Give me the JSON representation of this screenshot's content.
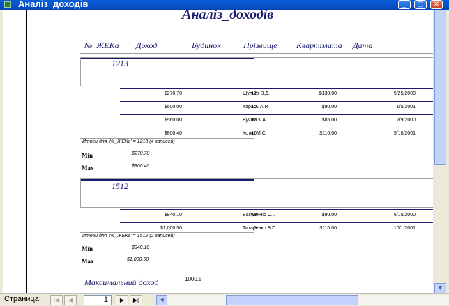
{
  "window": {
    "title": "Аналіз_доходів",
    "buttons": {
      "minimize": "_",
      "maximize": "□",
      "close": "✕"
    }
  },
  "report": {
    "title": "Аналіз_доходів",
    "headers": {
      "zheka": "№_ЖЕКа",
      "dohid": "Доход",
      "budynok": "Будинок",
      "prizvyshche": "Прізвище",
      "kvartplata": "Квартплата",
      "data": "Дата"
    },
    "groups": [
      {
        "id": "1213",
        "rows": [
          {
            "dohid": "$270.70",
            "budynok": "12",
            "prizvyshche": "Шульга В.Д.",
            "kvartplata": "$130.00",
            "data": "5/25/2000"
          },
          {
            "dohid": "$500.00",
            "budynok": "10",
            "prizvyshche": "Карась А.Р.",
            "kvartplata": "$90.00",
            "data": "1/5/2001"
          },
          {
            "dohid": "$560.00",
            "budynok": "12",
            "prizvyshche": "Бучма К.А.",
            "kvartplata": "$85.00",
            "data": "2/9/2000"
          },
          {
            "dohid": "$800.40",
            "budynok": "10",
            "prizvyshche": "Котко М.С.",
            "kvartplata": "$110.00",
            "data": "5/10/2001"
          }
        ],
        "summary": "Итоги для '№_ЖЕКа' = 1213 (4 записей)",
        "min_label": "Min",
        "min_value": "$270.70",
        "max_label": "Max",
        "max_value": "$800.40"
      },
      {
        "id": "1512",
        "rows": [
          {
            "dohid": "$940.10",
            "budynok": "59",
            "prizvyshche": "Бакуленко С.І.",
            "kvartplata": "$90.00",
            "data": "6/15/2000"
          },
          {
            "dohid": "$1,000.50",
            "budynok": "5",
            "prizvyshche": "Титаренко В.П.",
            "kvartplata": "$110.00",
            "data": "10/1/2001"
          }
        ],
        "summary": "Итоги для '№_ЖЕКа' = 1512 (2 записей)",
        "min_label": "Min",
        "min_value": "$940.10",
        "max_label": "Max",
        "max_value": "$1,000.50"
      }
    ],
    "max_dohid_label": "Максимальний доход",
    "max_dohid_value": "1000.5"
  },
  "navigation": {
    "page_label": "Страница:",
    "first": "|◀",
    "prev": "◀",
    "page_value": "1",
    "next": "▶",
    "last": "▶|"
  },
  "scrollbars": {
    "left_arrow": "◀",
    "down_arrow": "▼"
  }
}
